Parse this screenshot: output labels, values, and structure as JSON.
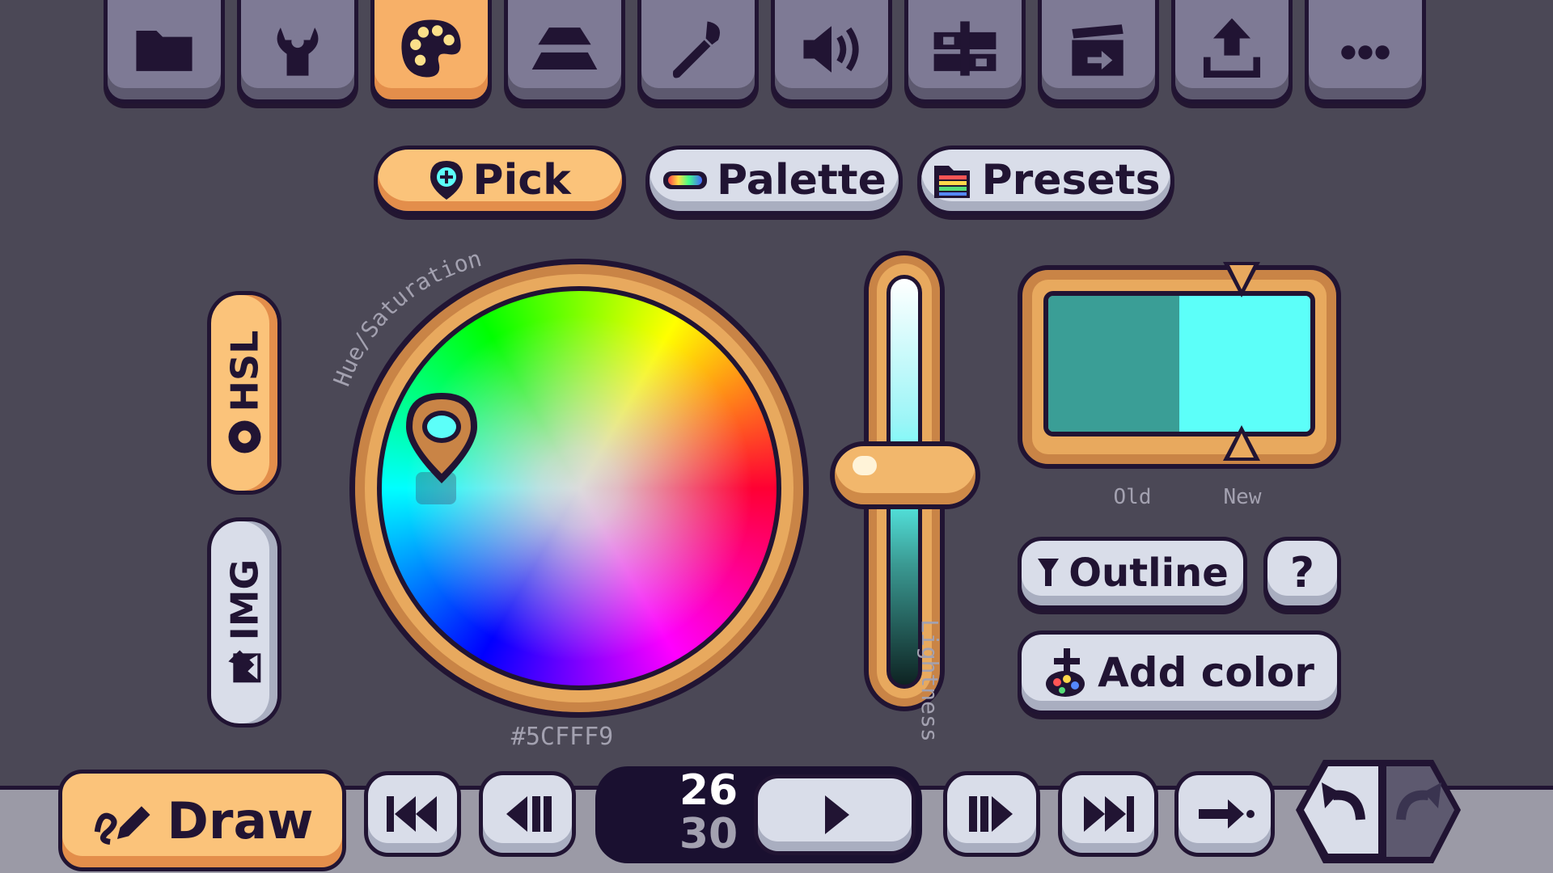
{
  "toolbar": {
    "items": [
      {
        "icon": "folder-icon"
      },
      {
        "icon": "wrench-icon"
      },
      {
        "icon": "palette-icon",
        "active": true
      },
      {
        "icon": "layers-icon"
      },
      {
        "icon": "brush-icon"
      },
      {
        "icon": "speaker-icon"
      },
      {
        "icon": "film-strip-icon"
      },
      {
        "icon": "clapperboard-icon"
      },
      {
        "icon": "upload-icon"
      },
      {
        "icon": "more-icon"
      }
    ]
  },
  "tabs": {
    "pick": "Pick",
    "palette": "Palette",
    "presets": "Presets"
  },
  "modes": {
    "hsl": "HSL",
    "img": "IMG"
  },
  "wheel": {
    "label": "Hue/Saturation",
    "hex": "#5CFFF9"
  },
  "slider": {
    "label": "Lightness",
    "value": 0.58
  },
  "swatch": {
    "old_label": "Old",
    "new_label": "New",
    "old_color": "#3a9e96",
    "new_color": "#5cfff9"
  },
  "actions": {
    "outline": "Outline",
    "help": "?",
    "add_color": "Add color"
  },
  "playback": {
    "draw": "Draw",
    "frame_current": "26",
    "frame_total": "30"
  },
  "colors": {
    "accent": "#f7b068",
    "outline": "#211433",
    "background": "#4b4856"
  }
}
